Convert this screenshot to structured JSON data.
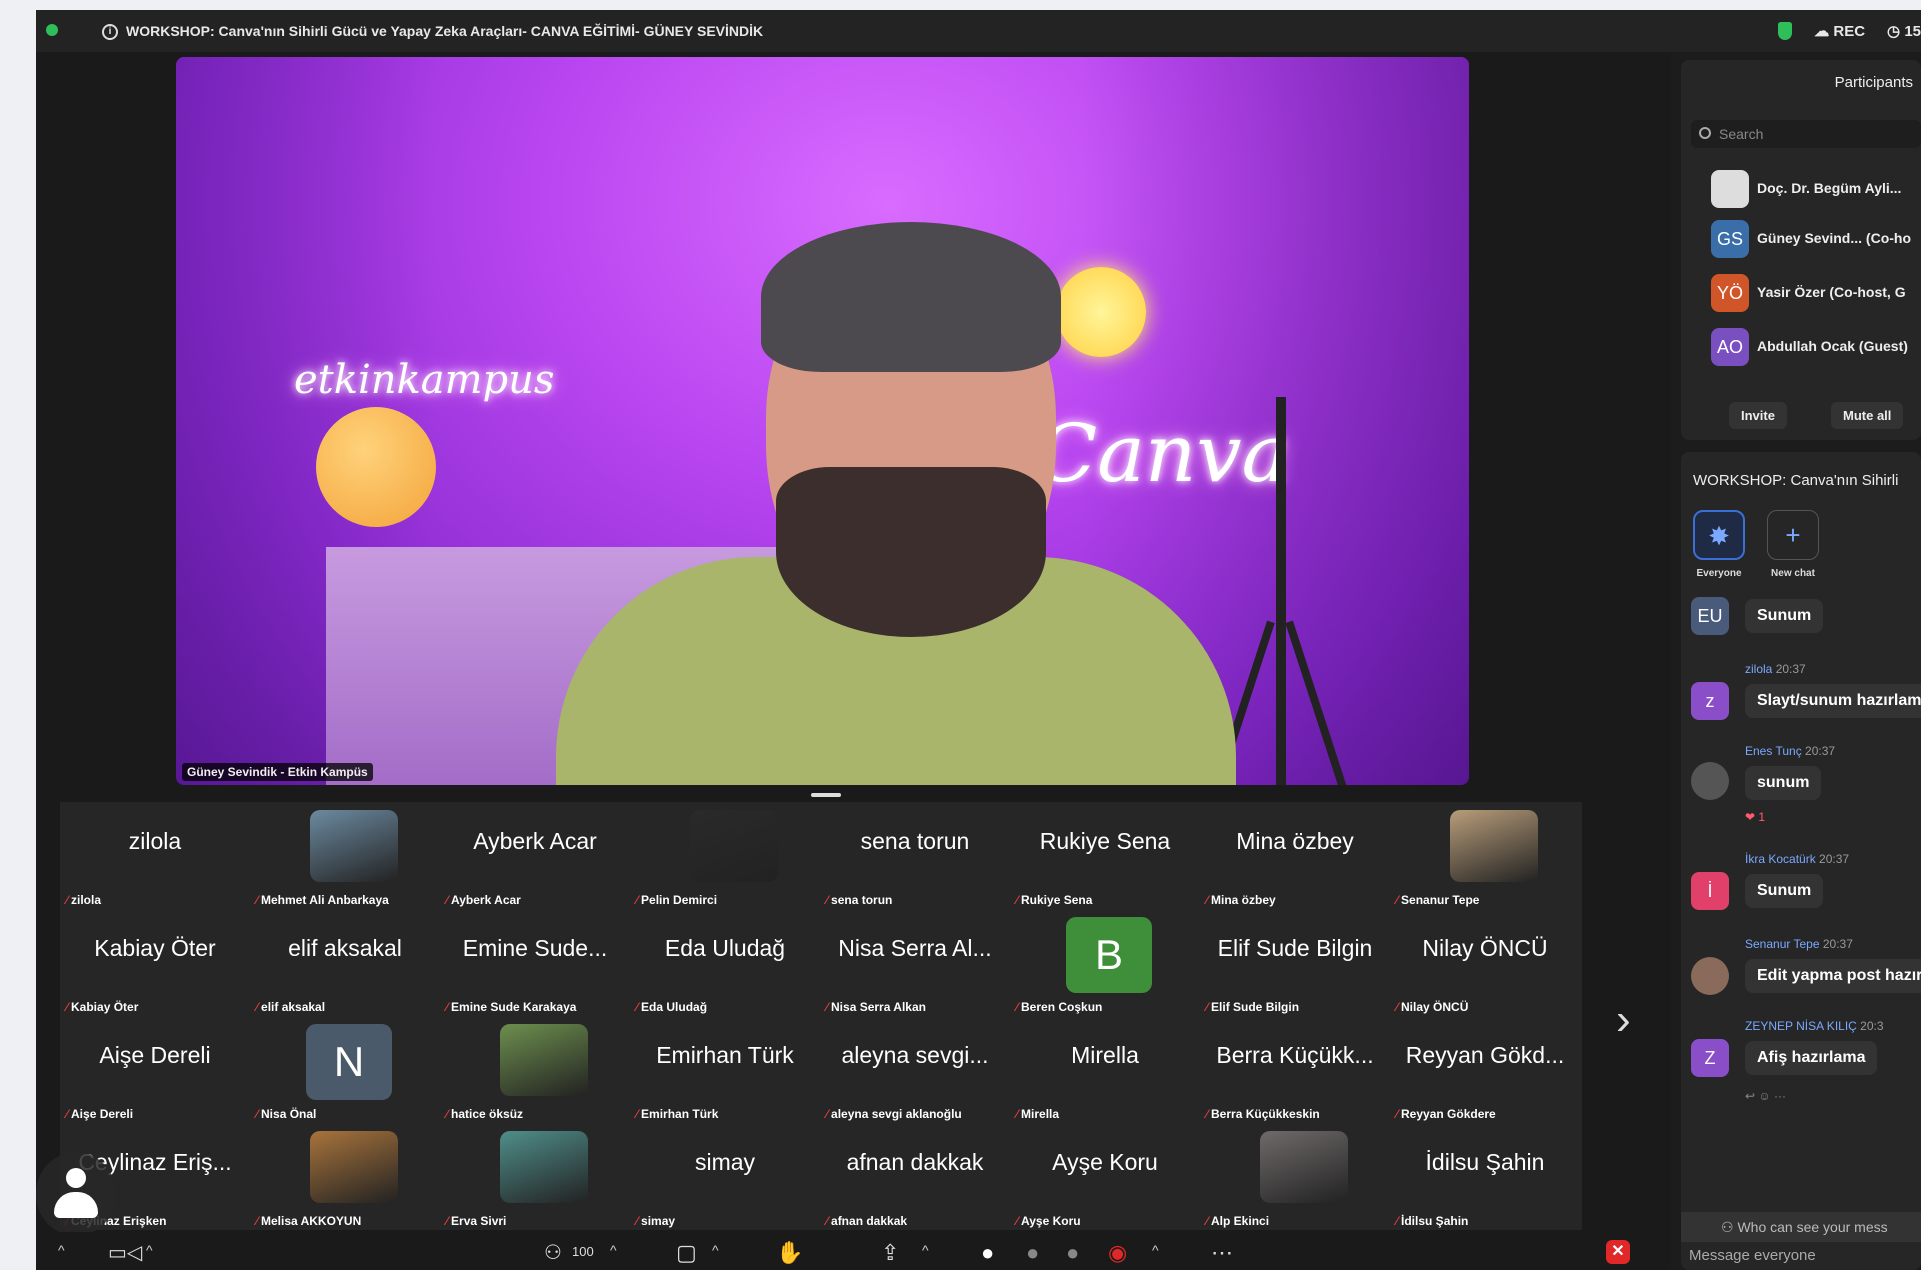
{
  "titlebar": {
    "meeting_title": "WORKSHOP: Canva'nın Sihirli Gücü ve Yapay Zeka Araçları- CANVA EĞİTİMİ- GÜNEY SEVİNDİK",
    "rec_label": "REC",
    "timer": "15"
  },
  "main_video": {
    "speaker_label": "Güney Sevindik - Etkin Kampüs",
    "bg_text_1": "etkinkampus",
    "bg_text_2": "Canva"
  },
  "grid": {
    "tiles": [
      {
        "name": "zilola",
        "sub": "zilola",
        "kind": "name"
      },
      {
        "name": "",
        "sub": "Mehmet Ali Anbarkaya",
        "kind": "photo",
        "color": "#6c8aa0"
      },
      {
        "name": "Ayberk Acar",
        "sub": "Ayberk Acar",
        "kind": "name"
      },
      {
        "name": "",
        "sub": "Pelin Demirci",
        "kind": "photo",
        "color": "#2a2a2a"
      },
      {
        "name": "sena torun",
        "sub": "sena torun",
        "kind": "name"
      },
      {
        "name": "Rukiye Sena",
        "sub": "Rukiye Sena",
        "kind": "name"
      },
      {
        "name": "Mina özbey",
        "sub": "Mina özbey",
        "kind": "name"
      },
      {
        "name": "",
        "sub": "Senanur Tepe",
        "kind": "photo",
        "color": "#b89d7a"
      },
      {
        "name": "Kabiay Öter",
        "sub": "Kabiay Öter",
        "kind": "name"
      },
      {
        "name": "elif aksakal",
        "sub": "elif aksakal",
        "kind": "name"
      },
      {
        "name": "Emine Sude...",
        "sub": "Emine Sude Karakaya",
        "kind": "name"
      },
      {
        "name": "Eda Uludağ",
        "sub": "Eda Uludağ",
        "kind": "name"
      },
      {
        "name": "Nisa Serra Al...",
        "sub": "Nisa Serra Alkan",
        "kind": "name"
      },
      {
        "name": "B",
        "sub": "Beren Coşkun",
        "kind": "letter",
        "color": "#3f8f3a"
      },
      {
        "name": "Elif Sude Bilgin",
        "sub": "Elif Sude Bilgin",
        "kind": "name"
      },
      {
        "name": "Nilay ÖNCÜ",
        "sub": "Nilay ÖNCÜ",
        "kind": "name"
      },
      {
        "name": "Aişe Dereli",
        "sub": "Aişe Dereli",
        "kind": "name"
      },
      {
        "name": "N",
        "sub": "Nisa Önal",
        "kind": "letter",
        "color": "#4a5a6a"
      },
      {
        "name": "",
        "sub": "hatice öksüz",
        "kind": "photo",
        "color": "#6d8f4e"
      },
      {
        "name": "Emirhan Türk",
        "sub": "Emirhan Türk",
        "kind": "name"
      },
      {
        "name": "aleyna sevgi...",
        "sub": "aleyna sevgi aklanoğlu",
        "kind": "name"
      },
      {
        "name": "Mirella",
        "sub": "Mirella",
        "kind": "name"
      },
      {
        "name": "Berra Küçükk...",
        "sub": "Berra Küçükkeskin",
        "kind": "name"
      },
      {
        "name": "Reyyan Gökd...",
        "sub": "Reyyan Gökdere",
        "kind": "name"
      },
      {
        "name": "Ceylinaz Eriş...",
        "sub": "Ceylinaz Erişken",
        "kind": "name"
      },
      {
        "name": "",
        "sub": "Melisa AKKOYUN",
        "kind": "photo",
        "color": "#a8743c"
      },
      {
        "name": "",
        "sub": "Erva Sivri",
        "kind": "photo",
        "color": "#4f8e8a"
      },
      {
        "name": "simay",
        "sub": "simay",
        "kind": "name"
      },
      {
        "name": "afnan dakkak",
        "sub": "afnan dakkak",
        "kind": "name"
      },
      {
        "name": "Ayşe Koru",
        "sub": "Ayşe Koru",
        "kind": "name"
      },
      {
        "name": "",
        "sub": "Alp Ekinci",
        "kind": "photo",
        "color": "#6f6a6a"
      },
      {
        "name": "İdilsu Şahin",
        "sub": "İdilsu Şahin",
        "kind": "name"
      }
    ]
  },
  "participants": {
    "title": "Participants",
    "search_placeholder": "Search",
    "rows": [
      {
        "initials": "",
        "name": "Doç. Dr. Begüm Ayli...",
        "color": "#dddddd"
      },
      {
        "initials": "GS",
        "name": "Güney Sevind... (Co-ho",
        "color": "#3a6ea8"
      },
      {
        "initials": "YÖ",
        "name": "Yasir Özer (Co-host, G",
        "color": "#d0562a"
      },
      {
        "initials": "AO",
        "name": "Abdullah Ocak (Guest)",
        "color": "#7a4fc0"
      }
    ],
    "invite_label": "Invite",
    "mute_all_label": "Mute all"
  },
  "chat": {
    "title": "WORKSHOP: Canva'nın Sihirli",
    "everyone_label": "Everyone",
    "new_chat_label": "New chat",
    "messages": [
      {
        "initials": "EU",
        "sender": "",
        "time": "",
        "text": "Sunum",
        "color": "#4a5a7a",
        "sender_color": "#7aa9ff"
      },
      {
        "initials": "z",
        "sender": "zilola",
        "time": "20:37",
        "text": "Slayt/sunum hazırlama",
        "color": "#8a4fc8",
        "sender_color": "#7aa9ff"
      },
      {
        "initials": "",
        "sender": "Enes Tunç",
        "time": "20:37",
        "text": "sunum",
        "color": "#555555",
        "sender_color": "#7aa9ff"
      },
      {
        "initials": "İ",
        "sender": "İkra Kocatürk",
        "time": "20:37",
        "text": "Sunum",
        "color": "#e0406a",
        "sender_color": "#7aa9ff"
      },
      {
        "initials": "",
        "sender": "Senanur Tepe",
        "time": "20:37",
        "text": "Edit yapma post hazır",
        "color": "#8a6a5a",
        "sender_color": "#7aa9ff"
      },
      {
        "initials": "Z",
        "sender": "ZEYNEP NİSA KILIÇ",
        "time": "20:3",
        "text": "Afiş hazırlama",
        "color": "#8a4fc8",
        "sender_color": "#7aa9ff"
      }
    ],
    "reaction": "❤ 1",
    "who_can_see": "Who can see your mess",
    "message_placeholder": "Message everyone"
  },
  "toolbar": {
    "participants_count": "100"
  }
}
